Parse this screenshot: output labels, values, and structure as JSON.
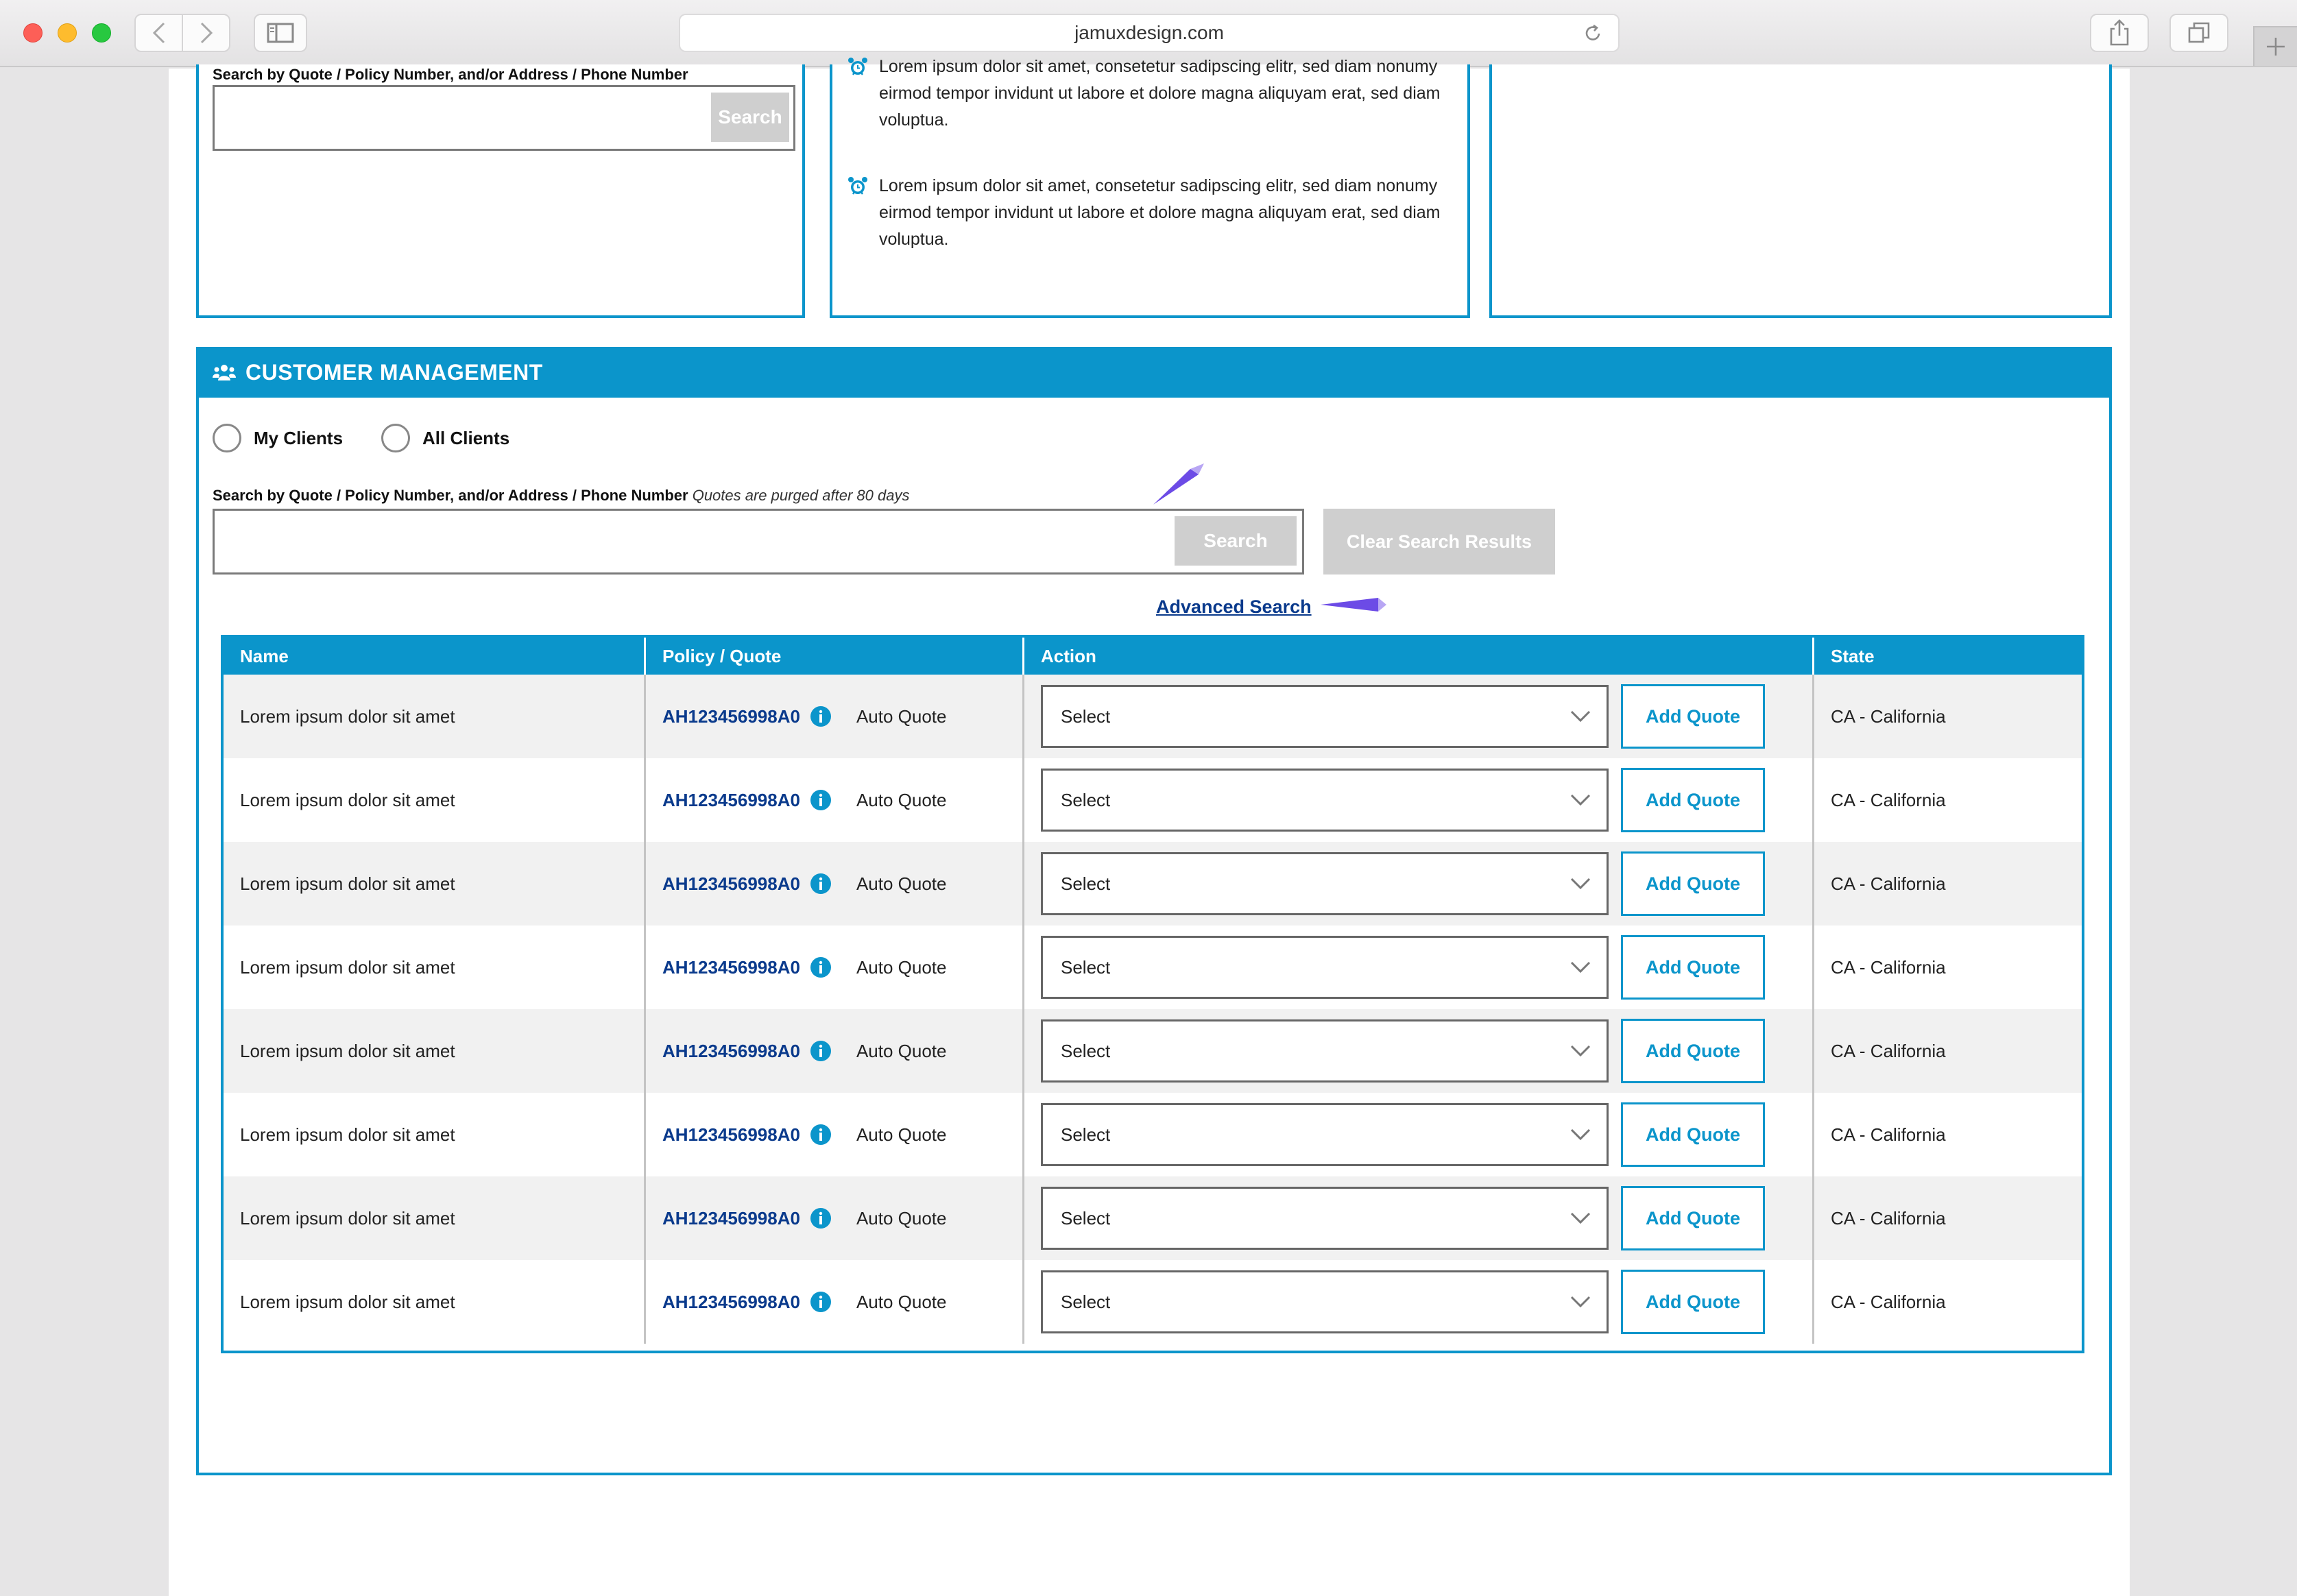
{
  "browser": {
    "url": "jamuxdesign.com"
  },
  "top_search": {
    "label": "Search by Quote / Policy Number, and/or Address / Phone Number",
    "value": "",
    "button": "Search"
  },
  "notices": [
    {
      "text": "Lorem ipsum dolor sit amet, consetetur sadipscing elitr, sed diam nonumy eirmod tempor invidunt ut labore et dolore magna aliquyam erat, sed diam voluptua."
    },
    {
      "text": "Lorem ipsum dolor sit amet, consetetur sadipscing elitr, sed diam nonumy eirmod tempor invidunt ut labore et dolore magna aliquyam erat, sed diam voluptua."
    }
  ],
  "customer_management": {
    "title": "CUSTOMER MANAGEMENT",
    "radios": [
      {
        "label": "My Clients",
        "selected": false
      },
      {
        "label": "All Clients",
        "selected": false
      }
    ],
    "search_label": "Search by Quote / Policy Number, and/or Address / Phone Number",
    "search_note": "Quotes are purged after 80 days",
    "search_value": "",
    "search_button": "Search",
    "clear_button": "Clear Search Results",
    "advanced_link": "Advanced Search",
    "table": {
      "columns": [
        "Name",
        "Policy / Quote",
        "Action",
        "State"
      ],
      "rows": [
        {
          "name": "Lorem ipsum dolor sit amet",
          "policy": "AH123456998A0",
          "type": "Auto Quote",
          "action": "Select",
          "add": "Add Quote",
          "state": "CA - California"
        },
        {
          "name": "Lorem ipsum dolor sit amet",
          "policy": "AH123456998A0",
          "type": "Auto Quote",
          "action": "Select",
          "add": "Add Quote",
          "state": "CA - California"
        },
        {
          "name": "Lorem ipsum dolor sit amet",
          "policy": "AH123456998A0",
          "type": "Auto Quote",
          "action": "Select",
          "add": "Add Quote",
          "state": "CA - California"
        },
        {
          "name": "Lorem ipsum dolor sit amet",
          "policy": "AH123456998A0",
          "type": "Auto Quote",
          "action": "Select",
          "add": "Add Quote",
          "state": "CA - California"
        },
        {
          "name": "Lorem ipsum dolor sit amet",
          "policy": "AH123456998A0",
          "type": "Auto Quote",
          "action": "Select",
          "add": "Add Quote",
          "state": "CA - California"
        },
        {
          "name": "Lorem ipsum dolor sit amet",
          "policy": "AH123456998A0",
          "type": "Auto Quote",
          "action": "Select",
          "add": "Add Quote",
          "state": "CA - California"
        },
        {
          "name": "Lorem ipsum dolor sit amet",
          "policy": "AH123456998A0",
          "type": "Auto Quote",
          "action": "Select",
          "add": "Add Quote",
          "state": "CA - California"
        },
        {
          "name": "Lorem ipsum dolor sit amet",
          "policy": "AH123456998A0",
          "type": "Auto Quote",
          "action": "Select",
          "add": "Add Quote",
          "state": "CA - California"
        }
      ]
    }
  },
  "colors": {
    "accent": "#0b95cb",
    "link": "#0a3a8c",
    "disabled_button": "#cfcfcf",
    "page_bg": "#e6e5e6"
  },
  "icons": [
    "back-icon",
    "forward-icon",
    "sidebar-icon",
    "reload-icon",
    "share-icon",
    "tabs-icon",
    "new-tab-icon",
    "alarm-clock-icon",
    "users-icon",
    "info-icon",
    "chevron-down-icon"
  ]
}
